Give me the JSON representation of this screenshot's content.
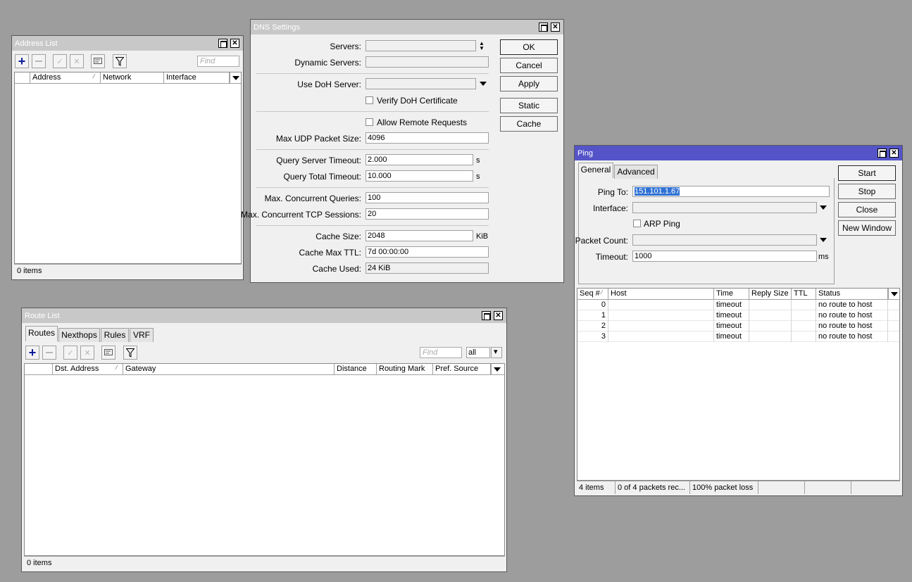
{
  "address_list": {
    "title": "Address List",
    "find_placeholder": "Find",
    "columns": [
      "Address",
      "Network",
      "Interface"
    ],
    "status": "0 items"
  },
  "dns": {
    "title": "DNS Settings",
    "labels": {
      "servers": "Servers:",
      "dynamic_servers": "Dynamic Servers:",
      "use_doh": "Use DoH Server:",
      "verify_doh": "Verify DoH Certificate",
      "allow_remote": "Allow Remote Requests",
      "max_udp": "Max UDP Packet Size:",
      "qs_timeout": "Query Server Timeout:",
      "qt_timeout": "Query Total Timeout:",
      "max_conc": "Max. Concurrent Queries:",
      "max_tcp": "Max. Concurrent TCP Sessions:",
      "cache_size": "Cache Size:",
      "cache_ttl": "Cache Max TTL:",
      "cache_used": "Cache Used:"
    },
    "values": {
      "max_udp": "4096",
      "qs_timeout": "2.000",
      "qt_timeout": "10.000",
      "max_conc": "100",
      "max_tcp": "20",
      "cache_size": "2048",
      "cache_ttl": "7d 00:00:00",
      "cache_used": "24 KiB"
    },
    "units": {
      "s": "s",
      "kib": "KiB"
    },
    "buttons": {
      "ok": "OK",
      "cancel": "Cancel",
      "apply": "Apply",
      "static": "Static",
      "cache": "Cache"
    }
  },
  "ping": {
    "title": "Ping",
    "tabs": [
      "General",
      "Advanced"
    ],
    "labels": {
      "ping_to": "Ping To:",
      "interface": "Interface:",
      "arp_ping": "ARP Ping",
      "packet_count": "Packet Count:",
      "timeout": "Timeout:"
    },
    "values": {
      "ping_to": "151.101.1.67",
      "timeout": "1000"
    },
    "units": {
      "ms": "ms"
    },
    "buttons": {
      "start": "Start",
      "stop": "Stop",
      "close": "Close",
      "new_window": "New Window"
    },
    "columns": [
      "Seq #",
      "Host",
      "Time",
      "Reply Size",
      "TTL",
      "Status"
    ],
    "rows": [
      {
        "seq": "0",
        "time": "timeout",
        "status": "no route to host"
      },
      {
        "seq": "1",
        "time": "timeout",
        "status": "no route to host"
      },
      {
        "seq": "2",
        "time": "timeout",
        "status": "no route to host"
      },
      {
        "seq": "3",
        "time": "timeout",
        "status": "no route to host"
      }
    ],
    "status": {
      "items": "4 items",
      "received": "0 of 4 packets rec...",
      "loss": "100% packet loss"
    }
  },
  "route_list": {
    "title": "Route List",
    "tabs": [
      "Routes",
      "Nexthops",
      "Rules",
      "VRF"
    ],
    "find_placeholder": "Find",
    "filter_value": "all",
    "columns": [
      "Dst. Address",
      "Gateway",
      "Distance",
      "Routing Mark",
      "Pref. Source"
    ],
    "status": "0 items"
  },
  "colors": {
    "active_titlebar": "#5454c8",
    "inactive_titlebar": "#c8c8c8",
    "desktop": "#9d9d9d",
    "selection": "#3072d4"
  }
}
